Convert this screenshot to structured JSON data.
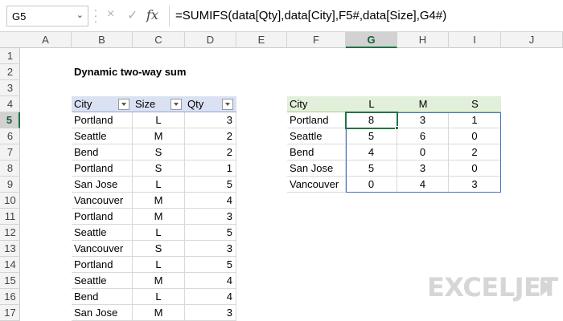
{
  "name_box": "G5",
  "formula": "=SUMIFS(data[Qty],data[City],F5#,data[Size],G4#)",
  "columns": [
    "A",
    "B",
    "C",
    "D",
    "E",
    "F",
    "G",
    "H",
    "I",
    "J"
  ],
  "rows": [
    "1",
    "2",
    "3",
    "4",
    "5",
    "6",
    "7",
    "8",
    "9",
    "10",
    "11",
    "12",
    "13",
    "14",
    "15",
    "16",
    "17"
  ],
  "title": "Dynamic two-way sum",
  "data_table": {
    "headers": [
      "City",
      "Size",
      "Qty"
    ],
    "rows": [
      [
        "Portland",
        "L",
        "3"
      ],
      [
        "Seattle",
        "M",
        "2"
      ],
      [
        "Bend",
        "S",
        "2"
      ],
      [
        "Portland",
        "S",
        "1"
      ],
      [
        "San Jose",
        "L",
        "5"
      ],
      [
        "Vancouver",
        "M",
        "4"
      ],
      [
        "Portland",
        "M",
        "3"
      ],
      [
        "Seattle",
        "L",
        "5"
      ],
      [
        "Vancouver",
        "S",
        "3"
      ],
      [
        "Portland",
        "L",
        "5"
      ],
      [
        "Seattle",
        "M",
        "4"
      ],
      [
        "Bend",
        "L",
        "4"
      ],
      [
        "San Jose",
        "M",
        "3"
      ]
    ]
  },
  "summary_table": {
    "headers": [
      "City",
      "L",
      "M",
      "S"
    ],
    "rows": [
      [
        "Portland",
        "8",
        "3",
        "1"
      ],
      [
        "Seattle",
        "5",
        "6",
        "0"
      ],
      [
        "Bend",
        "4",
        "0",
        "2"
      ],
      [
        "San Jose",
        "5",
        "3",
        "0"
      ],
      [
        "Vancouver",
        "0",
        "4",
        "3"
      ]
    ]
  },
  "logo_text": "EXCELJET",
  "colors": {
    "accent": "#217346",
    "table_header": "#d9e1f2",
    "summary_header": "#e2efda",
    "spill_border": "#4472c4"
  },
  "icons": {
    "cancel": "×",
    "confirm": "✓",
    "function": "fx"
  }
}
